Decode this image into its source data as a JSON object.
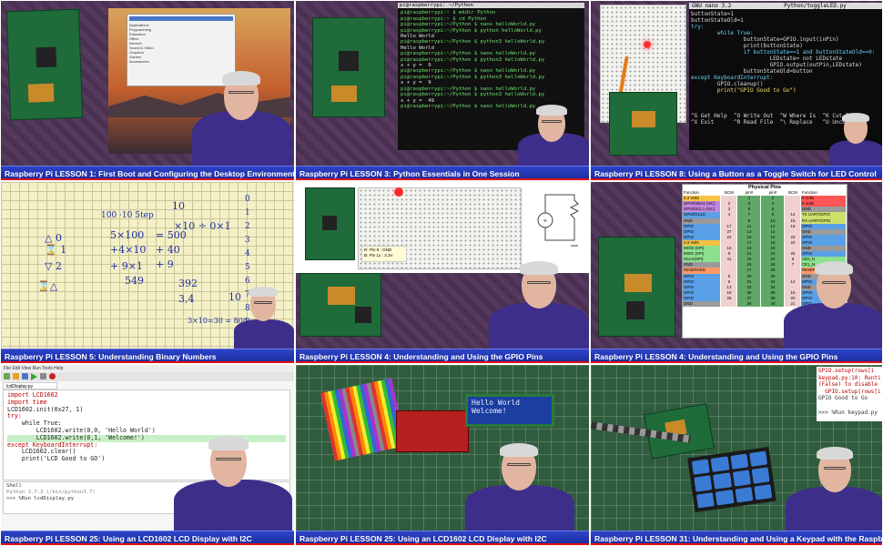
{
  "tiles": [
    {
      "caption": "Raspberry Pi LESSON 1: First Boot and Configuring the Desktop Environment",
      "screen": {
        "taskbar_note": "Raspberry Pi desktop menu"
      }
    },
    {
      "caption": "Raspberry Pi LESSON 3: Python Essentials in One Session",
      "terminal": {
        "title": "pi@raspberrypi: ~/Python",
        "lines": [
          "pi@raspberrypi:~ $ mkdir Python",
          "pi@raspberrypi:~ $ cd Python",
          "pi@raspberrypi:~/Python $ nano helloWorld.py",
          "pi@raspberrypi:~/Python $ python helloWorld.py",
          "Hello World",
          "pi@raspberrypi:~/Python $ python3 helloWorld.py",
          "Hello World",
          "pi@raspberrypi:~/Python $ nano helloWorld.py",
          "pi@raspberrypi:~/Python $ python3 helloWorld.py",
          "x + y =  9",
          "pi@raspberrypi:~/Python $ nano helloWorld.py",
          "pi@raspberrypi:~/Python $ python3 helloWorld.py",
          "x + y =  9",
          "pi@raspberrypi:~/Python $ nano helloWorld.py",
          "pi@raspberrypi:~/Python $ python3 helloWorld.py",
          "x + y =  49",
          "pi@raspberrypi:~/Python $ nano helloWorld.py"
        ]
      }
    },
    {
      "caption": "Raspberry Pi LESSON 8: Using a Button as a Toggle Switch for LED Control",
      "nano": {
        "title_left": "GNU nano 3.2",
        "title_right": "Python/toggleLED.py",
        "lines": [
          "buttonState=1",
          "buttonStateOld=1",
          "try:",
          "        while True:",
          "                buttonState=GPIO.input(inPin)",
          "                print(buttonState)",
          "                if buttonState==1 and buttonStateOld==0:",
          "                        LEDstate= not LEDstate",
          "                        GPIO.output(outPin,LEDstate)",
          "                buttonStateOld=button",
          "except KeyboardInterrupt:",
          "        GPIO.cleanup()",
          "        print(\"GPIO Good to Go\")"
        ],
        "shortcuts": "^G Get Help  ^O Write Out  ^W Where Is  ^K Cut Te\n^X Exit      ^R Read File  ^\\ Replace   ^U Uncut"
      }
    },
    {
      "caption": "Raspberry Pi LESSON 5: Understanding Binary Numbers"
    },
    {
      "caption": "Raspberry Pi LESSON 4: Understanding and Using the GPIO Pins",
      "note": {
        "line1": "R: Pin 9 : GND",
        "line2": "B: Pin 11 : 3.3V"
      }
    },
    {
      "caption": "Raspberry Pi LESSON 4: Understanding and Using the GPIO Pins",
      "pins": {
        "title": "Physical Pins",
        "head_left": [
          "Function",
          "BCM",
          "pin#"
        ],
        "head_right": [
          "pin#",
          "BCM",
          "Function"
        ],
        "left": [
          [
            "3.3 Volts",
            "",
            "1",
            "#f6c243"
          ],
          [
            "GPIO/SDA1 (I2C)",
            "2",
            "3",
            "#c486e0"
          ],
          [
            "GPIO/SCL1 (I2C)",
            "3",
            "5",
            "#c486e0"
          ],
          [
            "GPIO/GCLK",
            "4",
            "7",
            "#5aa0e6"
          ],
          [
            "GND",
            "",
            "9",
            "#9a9a9a"
          ],
          [
            "GPIO",
            "17",
            "11",
            "#5aa0e6"
          ],
          [
            "GPIO",
            "27",
            "13",
            "#5aa0e6"
          ],
          [
            "GPIO",
            "22",
            "15",
            "#5aa0e6"
          ],
          [
            "3.3 Volts",
            "",
            "17",
            "#f6c243"
          ],
          [
            "MOSI (SPI)",
            "10",
            "19",
            "#8de08d"
          ],
          [
            "MISO (SPI)",
            "9",
            "21",
            "#8de08d"
          ],
          [
            "SCLK(SPI)",
            "11",
            "23",
            "#8de08d"
          ],
          [
            "GND",
            "",
            "25",
            "#9a9a9a"
          ],
          [
            "RESERVED",
            "",
            "27",
            "#ff9966"
          ],
          [
            "GPIO",
            "5",
            "29",
            "#5aa0e6"
          ],
          [
            "GPIO",
            "6",
            "31",
            "#5aa0e6"
          ],
          [
            "GPIO",
            "13",
            "33",
            "#5aa0e6"
          ],
          [
            "GPIO",
            "19",
            "35",
            "#5aa0e6"
          ],
          [
            "GPIO",
            "26",
            "37",
            "#5aa0e6"
          ],
          [
            "GND",
            "",
            "39",
            "#9a9a9a"
          ]
        ],
        "right": [
          [
            "2",
            "",
            "5 Volts",
            "#ff5555"
          ],
          [
            "4",
            "",
            "5 Volts",
            "#ff5555"
          ],
          [
            "6",
            "",
            "GND",
            "#9a9a9a"
          ],
          [
            "8",
            "14",
            "TX UART/GPIO",
            "#cfe06a"
          ],
          [
            "10",
            "15",
            "RX UART/GPIO",
            "#cfe06a"
          ],
          [
            "12",
            "18",
            "GPIO",
            "#5aa0e6"
          ],
          [
            "14",
            "",
            "GND",
            "#9a9a9a"
          ],
          [
            "16",
            "23",
            "GPIO",
            "#5aa0e6"
          ],
          [
            "18",
            "24",
            "GPIO",
            "#5aa0e6"
          ],
          [
            "20",
            "",
            "GND",
            "#9a9a9a"
          ],
          [
            "22",
            "25",
            "GPIO",
            "#5aa0e6"
          ],
          [
            "24",
            "8",
            "CE0_N",
            "#8de08d"
          ],
          [
            "26",
            "7",
            "CE1_N",
            "#8de08d"
          ],
          [
            "28",
            "",
            "RESERVED",
            "#ff9966"
          ],
          [
            "30",
            "",
            "GND",
            "#9a9a9a"
          ],
          [
            "32",
            "12",
            "GPIO",
            "#5aa0e6"
          ],
          [
            "34",
            "",
            "GND",
            "#9a9a9a"
          ],
          [
            "36",
            "16",
            "GPIO",
            "#5aa0e6"
          ],
          [
            "38",
            "20",
            "GPIO",
            "#5aa0e6"
          ],
          [
            "40",
            "21",
            "GPIO",
            "#5aa0e6"
          ]
        ]
      }
    },
    {
      "caption": "Raspberry Pi LESSON 25: Using an LCD1602 LCD Display with I2C",
      "ide": {
        "menu": "File  Edit  View  Run  Tools  Help",
        "tab": "lcdDisplay.py",
        "code": [
          "import LCD1602",
          "import time",
          "LCD1602.init(0x27, 1)",
          "try:",
          "    while True:",
          "        LCD1602.write(0,0, 'Hello World')",
          "        LCD1602.write(0,1, 'Welcome!')",
          "except KeyboardInterrupt:",
          "    LCD1602.clear()",
          "    print('LCD Good to GO')"
        ],
        "shell_label": "Shell",
        "shell_line1": "Python 3.7.3 (/bin/python3.7)",
        "shell_line2": ">>> %Run lcdDisplay.py"
      }
    },
    {
      "caption": "Raspberry Pi LESSON 25: Using an LCD1602 LCD Display with I2C",
      "lcd": {
        "line1": "Hello World",
        "line2": "Welcome!"
      }
    },
    {
      "caption": "Raspberry Pi LESSON 31: Understanding and Using a Keypad with the Raspberry Pi",
      "shell": [
        "GPIO.setup(rows[i",
        "keypad.py:10: Runti",
        "(False) to disable",
        "  GPIO.setup(rows[i",
        "GPIO Good to Go",
        "",
        ">>> %Run keypad.py"
      ]
    }
  ],
  "colors": {
    "caption_bg": "#2036b8",
    "caption_accent": "#e01010",
    "shirt": "#3d2e8a"
  }
}
